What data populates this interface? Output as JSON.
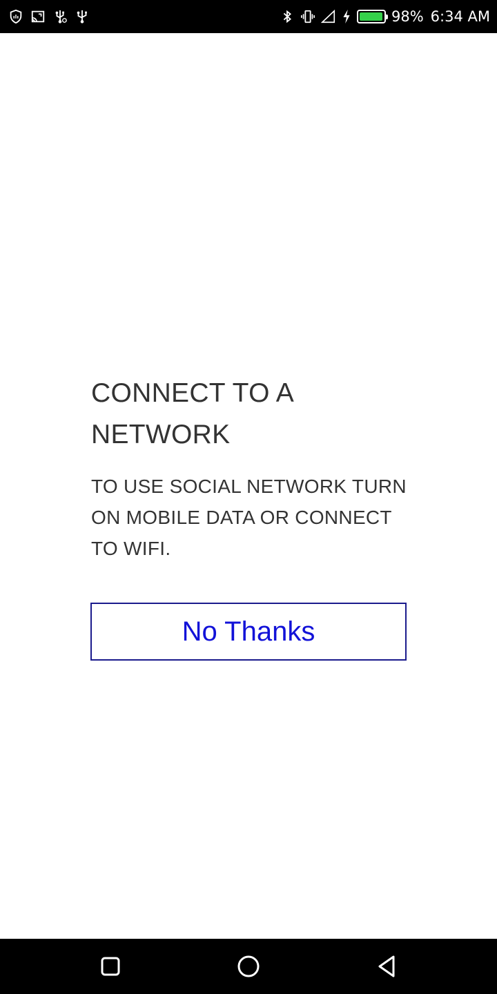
{
  "status_bar": {
    "left_icons": [
      "shield-icon",
      "cast-icon",
      "usb-debug-icon",
      "usb-icon"
    ],
    "right_icons": [
      "bluetooth-icon",
      "vibrate-icon",
      "signal-icon",
      "charging-icon",
      "battery-icon"
    ],
    "battery_level": 0.98,
    "battery_percent": "98%",
    "time": "6:34 AM",
    "battery_color": "#35d14b"
  },
  "dialog": {
    "title": "CONNECT TO A NETWORK",
    "message": "TO USE SOCIAL NETWORK TURN ON MOBILE DATA OR CONNECT TO WIFI.",
    "button_label": "No Thanks",
    "button_color": "#1212d8",
    "button_border_color": "#1a1a8c"
  },
  "nav_bar": {
    "buttons": [
      "recents-icon",
      "home-icon",
      "back-icon"
    ]
  }
}
